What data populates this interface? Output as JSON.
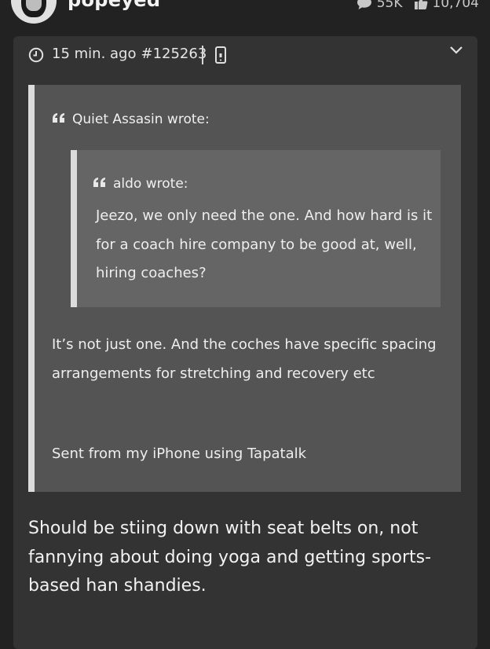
{
  "user": {
    "name": "popeyed"
  },
  "stats": {
    "comments": "55K",
    "likes": "10,704"
  },
  "post": {
    "time": "15 min. ago",
    "id": "#125263",
    "quote": {
      "author_label": "Quiet Assasin wrote:",
      "nested_quote": {
        "author_label": "aldo wrote:",
        "text": "Jeezo, we only need the one. And how hard is it for a coach hire company to be good at, well, hiring coaches?"
      },
      "text": "It’s not just one. And the coches have specific spacing arrangements for stretching and recovery etc",
      "signature": "Sent from my iPhone using Tapatalk"
    },
    "reply": "Should be stiing down with seat belts on, not fannying about doing yoga and getting sports-based han shandies."
  },
  "colors": {
    "page_bg": "#222222",
    "post_bg": "#333333",
    "quote_bg": "#545454",
    "nested_quote_bg": "#656565",
    "quote_bar": "#dcdcdc"
  },
  "icons": {
    "comments": "speech-bubble-icon",
    "likes": "thumbs-up-icon",
    "time": "clock-icon",
    "device": "mobile-device-icon",
    "expand": "chevron-down-icon",
    "quote": "quote-mark-icon"
  }
}
